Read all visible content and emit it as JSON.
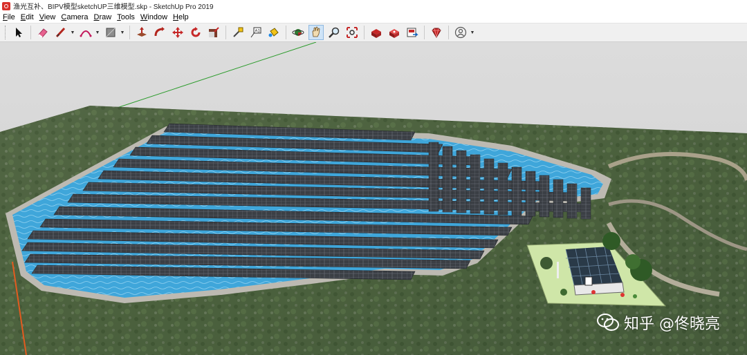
{
  "window": {
    "title": "渔光互补、BIPV模型sketchUP三维模型.skp - SketchUp Pro 2019"
  },
  "menu": {
    "items": [
      {
        "mnemonic": "F",
        "rest": "ile"
      },
      {
        "mnemonic": "E",
        "rest": "dit"
      },
      {
        "mnemonic": "V",
        "rest": "iew"
      },
      {
        "mnemonic": "C",
        "rest": "amera"
      },
      {
        "mnemonic": "D",
        "rest": "raw"
      },
      {
        "mnemonic": "T",
        "rest": "ools"
      },
      {
        "mnemonic": "W",
        "rest": "indow"
      },
      {
        "mnemonic": "H",
        "rest": "elp"
      }
    ]
  },
  "toolbar": {
    "tools": [
      "select-icon",
      "eraser-icon",
      "line-icon",
      "arc-icon",
      "rectangle-icon",
      "push-pull-icon",
      "follow-me-icon",
      "move-icon",
      "rotate-icon",
      "scale-icon",
      "tape-measure-icon",
      "text-icon",
      "paint-bucket-icon",
      "orbit-icon",
      "pan-icon",
      "zoom-icon",
      "zoom-extents-icon",
      "warehouse-icon",
      "extension-icon",
      "send-layout-icon",
      "ruby-icon",
      "account-icon"
    ],
    "active_tool": "pan-icon"
  },
  "watermark": {
    "text": "知乎 @佟晓亮"
  },
  "colors": {
    "water": "#3aa2d8",
    "panel": "#3a3d42",
    "terrain": "#4f6a3f",
    "axis_red": "#d11",
    "axis_green": "#2a9b2a",
    "brand": "#d8312b"
  }
}
